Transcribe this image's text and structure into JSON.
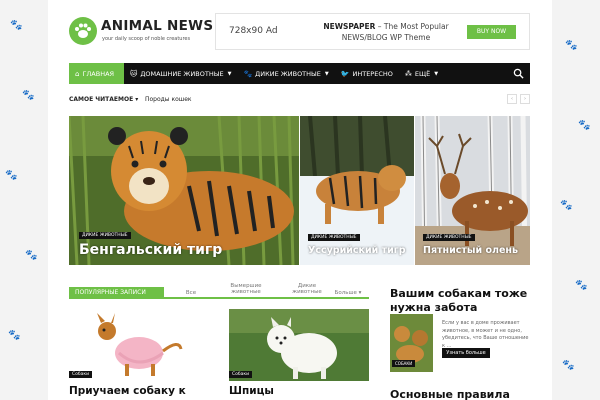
{
  "header": {
    "logo_title": "ANIMAL NEWS",
    "logo_tagline": "your daily scoop of noble creatures",
    "ad_size": "728x90 Ad",
    "ad_line1_bold": "NEWSPAPER",
    "ad_line1_rest": " – The Most Popular",
    "ad_line2": "NEWS/BLOG WP Theme",
    "ad_button": "BUY NOW"
  },
  "nav": {
    "items": [
      {
        "label": "ГЛАВНАЯ",
        "icon": "home-icon"
      },
      {
        "label": "ДОМАШНИЕ ЖИВОТНЫЕ",
        "icon": "cat-icon"
      },
      {
        "label": "ДИКИЕ ЖИВОТНЫЕ",
        "icon": "paw-icon"
      },
      {
        "label": "ИНТЕРЕСНО",
        "icon": "bird-icon"
      },
      {
        "label": "ЕЩЁ",
        "icon": "grid-icon"
      }
    ]
  },
  "trending": {
    "label": "САМОЕ ЧИТАЕМОЕ",
    "item": "Породы кошек"
  },
  "hero": [
    {
      "category": "ДИКИЕ ЖИВОТНЫЕ",
      "title": "Бенгальский тигр"
    },
    {
      "category": "ДИКИЕ ЖИВОТНЫЕ",
      "title": "Уссурийский тигр"
    },
    {
      "category": "ДИКИЕ ЖИВОТНЫЕ",
      "title": "Пятнистый олень"
    }
  ],
  "tabs": {
    "main": "ПОПУЛЯРНЫЕ ЗАПИСИ",
    "all": "Все",
    "t2_line1": "Вымершие",
    "t2_line2": "животные",
    "t3_line1": "Дикие",
    "t3_line2": "животные",
    "more": "Больше"
  },
  "cards": [
    {
      "category": "Собаки",
      "title": "Приучаем собаку к"
    },
    {
      "category": "Собаки",
      "title": "Шпицы"
    }
  ],
  "sidebar": {
    "title1_line1": "Вашим собакам тоже",
    "title1_line2": "нужна забота",
    "text": "Если у вас в доме проживает животное, в может и не одно, убедитесь, что Ваше отношение к ...",
    "thumb_category": "СОБАКИ",
    "button": "Узнать больше",
    "title2": "Основные правила"
  },
  "colors": {
    "accent": "#6ec046",
    "nav_bg": "#111111"
  }
}
